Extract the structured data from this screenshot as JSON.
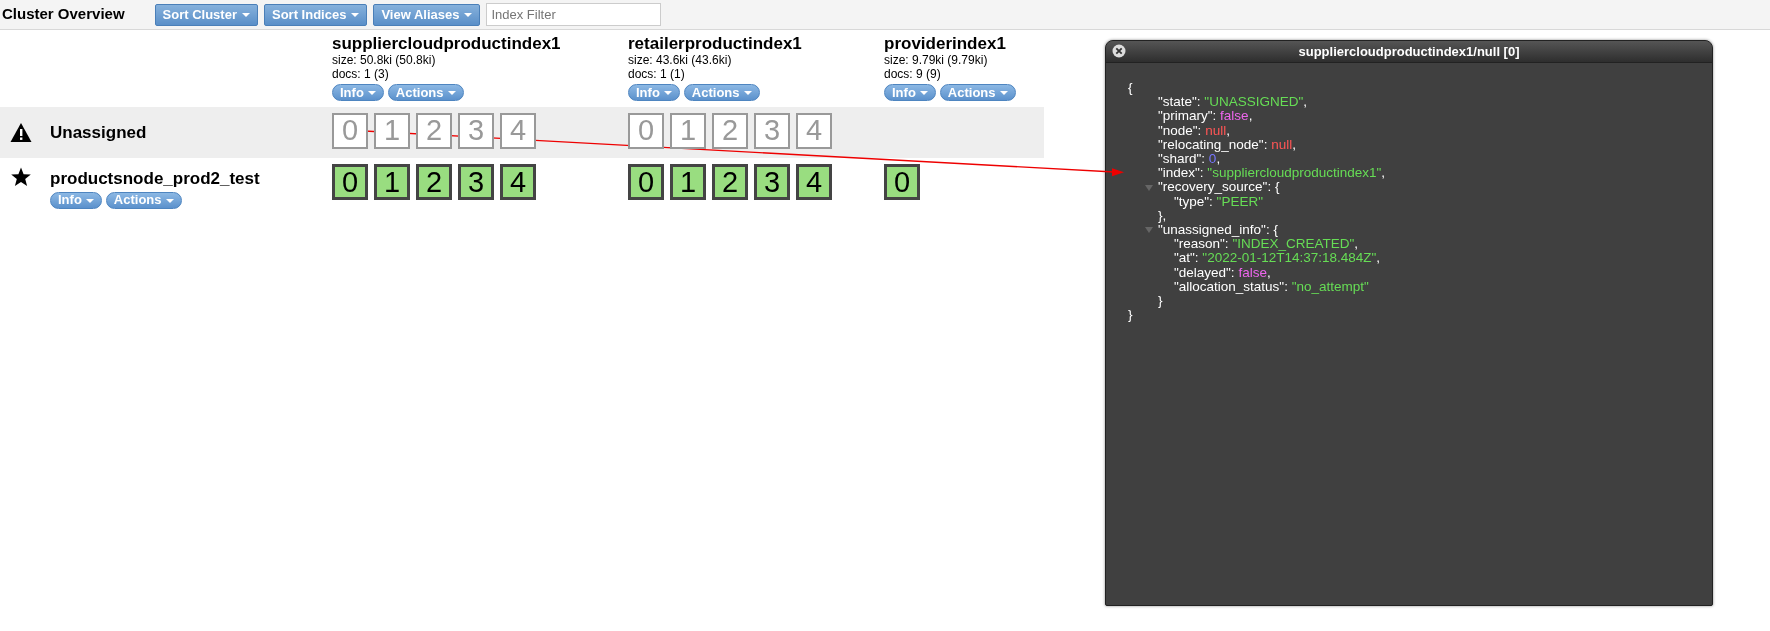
{
  "header": {
    "title": "Cluster Overview",
    "buttons": [
      {
        "label": "Sort Cluster"
      },
      {
        "label": "Sort Indices"
      },
      {
        "label": "View Aliases"
      }
    ],
    "filter": {
      "placeholder": "Index Filter"
    }
  },
  "indices": [
    {
      "name": "suppliercloudproductindex1",
      "size": "size: 50.8ki (50.8ki)",
      "docs": "docs: 1 (3)",
      "buttons": [
        "Info",
        "Actions"
      ]
    },
    {
      "name": "retailerproductindex1",
      "size": "size: 43.6ki (43.6ki)",
      "docs": "docs: 1 (1)",
      "buttons": [
        "Info",
        "Actions"
      ]
    },
    {
      "name": "providerindex1",
      "size": "size: 9.79ki (9.79ki)",
      "docs": "docs: 9 (9)",
      "buttons": [
        "Info",
        "Actions"
      ]
    }
  ],
  "rows": [
    {
      "kind": "unassigned",
      "name": "Unassigned",
      "shards": [
        [
          {
            "label": "0",
            "kind": "unassigned"
          },
          {
            "label": "1",
            "kind": "unassigned"
          },
          {
            "label": "2",
            "kind": "unassigned"
          },
          {
            "label": "3",
            "kind": "unassigned"
          },
          {
            "label": "4",
            "kind": "unassigned"
          }
        ],
        [
          {
            "label": "0",
            "kind": "unassigned"
          },
          {
            "label": "1",
            "kind": "unassigned"
          },
          {
            "label": "2",
            "kind": "unassigned"
          },
          {
            "label": "3",
            "kind": "unassigned"
          },
          {
            "label": "4",
            "kind": "unassigned"
          }
        ]
      ]
    },
    {
      "kind": "node",
      "name": "productsnode_prod2_test",
      "buttons": [
        "Info",
        "Actions"
      ],
      "shards": [
        [
          {
            "label": "0",
            "kind": "started"
          },
          {
            "label": "1",
            "kind": "started"
          },
          {
            "label": "2",
            "kind": "started"
          },
          {
            "label": "3",
            "kind": "started"
          },
          {
            "label": "4",
            "kind": "started"
          }
        ],
        [
          {
            "label": "0",
            "kind": "started"
          },
          {
            "label": "1",
            "kind": "started"
          },
          {
            "label": "2",
            "kind": "started"
          },
          {
            "label": "3",
            "kind": "started"
          },
          {
            "label": "4",
            "kind": "started"
          }
        ],
        [
          {
            "label": "0",
            "kind": "started"
          }
        ]
      ]
    }
  ],
  "dialog": {
    "title": "suppliercloudproductindex1/null [0]",
    "open": "{",
    "close": "}",
    "fields": [
      {
        "key": "\"state\":",
        "value": "\"UNASSIGNED\"",
        "comma": ",",
        "kind": "string"
      },
      {
        "key": "\"primary\":",
        "value": "false",
        "comma": ",",
        "kind": "boolean"
      },
      {
        "key": "\"node\":",
        "value": "null",
        "comma": ",",
        "kind": "null"
      },
      {
        "key": "\"relocating_node\":",
        "value": "null",
        "comma": ",",
        "kind": "null"
      },
      {
        "key": "\"shard\":",
        "value": "0",
        "comma": ",",
        "kind": "number"
      },
      {
        "key": "\"index\":",
        "value": "\"suppliercloudproductindex1\"",
        "comma": ",",
        "kind": "string"
      },
      {
        "key": "\"recovery_source\":",
        "value": "{",
        "kind": "object",
        "expanded": true,
        "close": "},",
        "children": [
          {
            "key": "\"type\":",
            "value": "\"PEER\"",
            "kind": "string"
          }
        ]
      },
      {
        "key": "\"unassigned_info\":",
        "value": "{",
        "kind": "object",
        "expanded": true,
        "close": "}",
        "children": [
          {
            "key": "\"reason\":",
            "value": "\"INDEX_CREATED\"",
            "comma": ",",
            "kind": "string"
          },
          {
            "key": "\"at\":",
            "value": "\"2022-01-12T14:37:18.484Z\"",
            "comma": ",",
            "kind": "string"
          },
          {
            "key": "\"delayed\":",
            "value": "false",
            "comma": ",",
            "kind": "boolean"
          },
          {
            "key": "\"allocation_status\":",
            "value": "\"no_attempt\"",
            "kind": "string"
          }
        ]
      }
    ]
  }
}
